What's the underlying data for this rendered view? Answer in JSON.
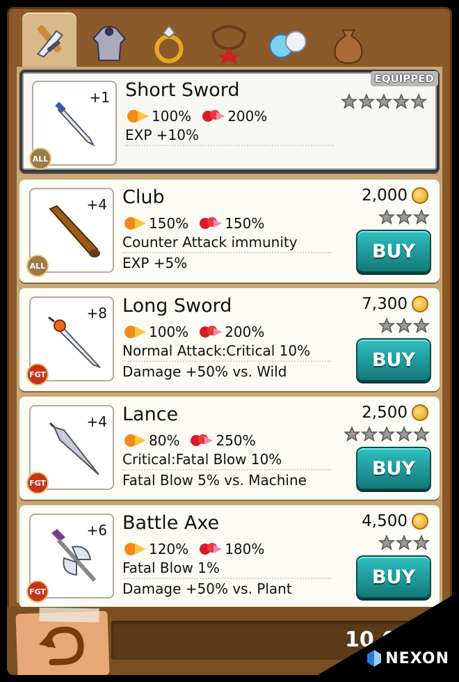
{
  "tabs": [
    {
      "name": "weapon",
      "icon": "sword-icon",
      "active": true
    },
    {
      "name": "armor",
      "icon": "armor-icon",
      "active": false
    },
    {
      "name": "ring",
      "icon": "ring-icon",
      "active": false
    },
    {
      "name": "necklace",
      "icon": "necklace-icon",
      "active": false
    },
    {
      "name": "gem",
      "icon": "gem-icon",
      "active": false
    },
    {
      "name": "bag",
      "icon": "bag-icon",
      "active": false
    }
  ],
  "items": [
    {
      "name": "Short Sword",
      "plus": "+1",
      "class": "ALL",
      "attack": "100%",
      "defense": "200%",
      "line1": "EXP +10%",
      "line2": "",
      "stars": 5,
      "equipped_label": "EQUIPPED",
      "price": "",
      "buy": ""
    },
    {
      "name": "Club",
      "plus": "+4",
      "class": "ALL",
      "attack": "150%",
      "defense": "150%",
      "line1": "Counter Attack immunity",
      "line2": "EXP +5%",
      "stars": 3,
      "equipped_label": "",
      "price": "2,000",
      "buy": "BUY"
    },
    {
      "name": "Long Sword",
      "plus": "+8",
      "class": "FGT",
      "attack": "100%",
      "defense": "200%",
      "line1": "Normal Attack:Critical 10%",
      "line2": "Damage +50% vs. Wild",
      "stars": 3,
      "equipped_label": "",
      "price": "7,300",
      "buy": "BUY"
    },
    {
      "name": "Lance",
      "plus": "+4",
      "class": "FGT",
      "attack": "80%",
      "defense": "250%",
      "line1": "Critical:Fatal Blow 10%",
      "line2": "Fatal Blow 5% vs. Machine",
      "stars": 5,
      "equipped_label": "",
      "price": "2,500",
      "buy": "BUY"
    },
    {
      "name": "Battle Axe",
      "plus": "+6",
      "class": "FGT",
      "attack": "120%",
      "defense": "180%",
      "line1": "Fatal Blow 1%",
      "line2": "Damage +50% vs. Plant",
      "stars": 3,
      "equipped_label": "",
      "price": "4,500",
      "buy": "BUY"
    }
  ],
  "bottom": {
    "currency": "10,0",
    "back_icon": "back-arrow-icon"
  },
  "brand": {
    "label": "NEXON"
  },
  "colors": {
    "buy": "#1e9a9a",
    "panel": "#c9a878",
    "frame": "#8a5a2b",
    "fgt": "#c8341a",
    "all": "#9a7a4a"
  }
}
